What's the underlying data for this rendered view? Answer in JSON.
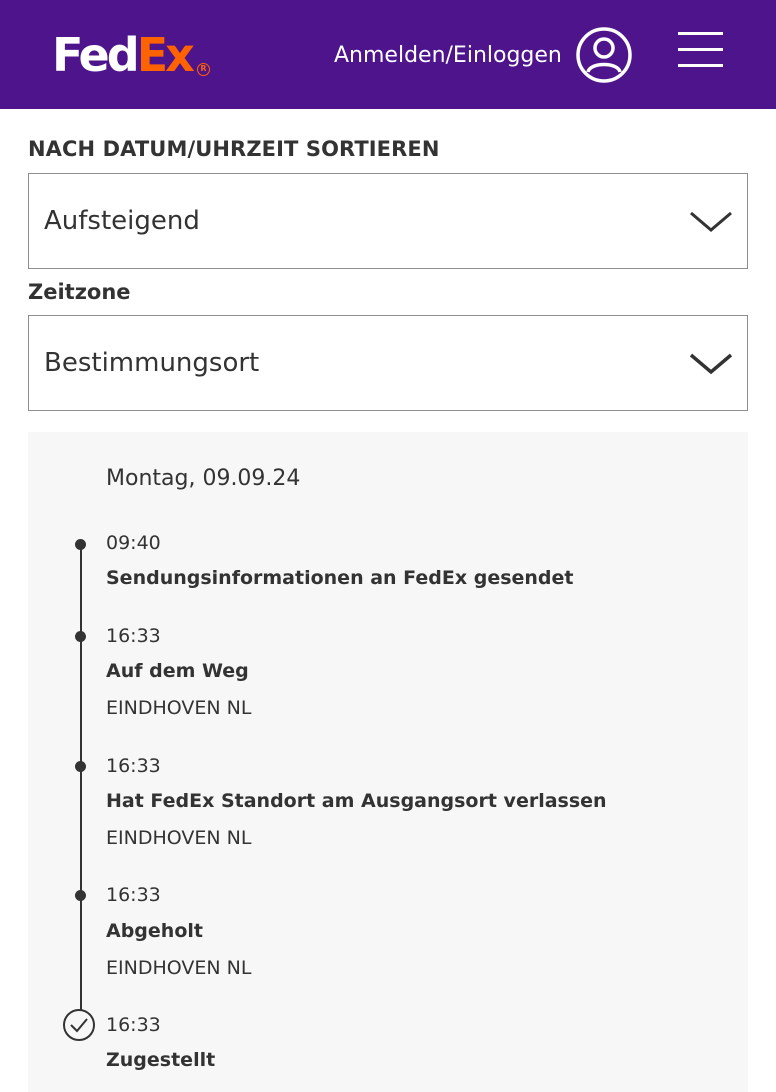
{
  "header": {
    "logo_fed": "Fed",
    "logo_ex": "Ex",
    "logo_reg": "R",
    "login_label": "Anmelden/Einloggen",
    "user_icon": "user-circle-icon",
    "menu_icon": "hamburger-menu-icon",
    "bg_color": "#4d148c",
    "accent_color": "#ff6200"
  },
  "sort": {
    "label": "NACH DATUM/UHRZEIT SORTIEREN",
    "value": "Aufsteigend"
  },
  "timezone": {
    "label": "Zeitzone",
    "value": "Bestimmungsort"
  },
  "history": {
    "date": "Montag, 09.09.24",
    "events": [
      {
        "time": "09:40",
        "title": "Sendungsinformationen an FedEx gesendet",
        "location": ""
      },
      {
        "time": "16:33",
        "title": "Auf dem Weg",
        "location": "EINDHOVEN NL"
      },
      {
        "time": "16:33",
        "title": "Hat FedEx Standort am Ausgangsort verlassen",
        "location": "EINDHOVEN NL"
      },
      {
        "time": "16:33",
        "title": "Abgeholt",
        "location": "EINDHOVEN NL"
      },
      {
        "time": "16:33",
        "title": "Zugestellt",
        "location": ""
      }
    ]
  }
}
